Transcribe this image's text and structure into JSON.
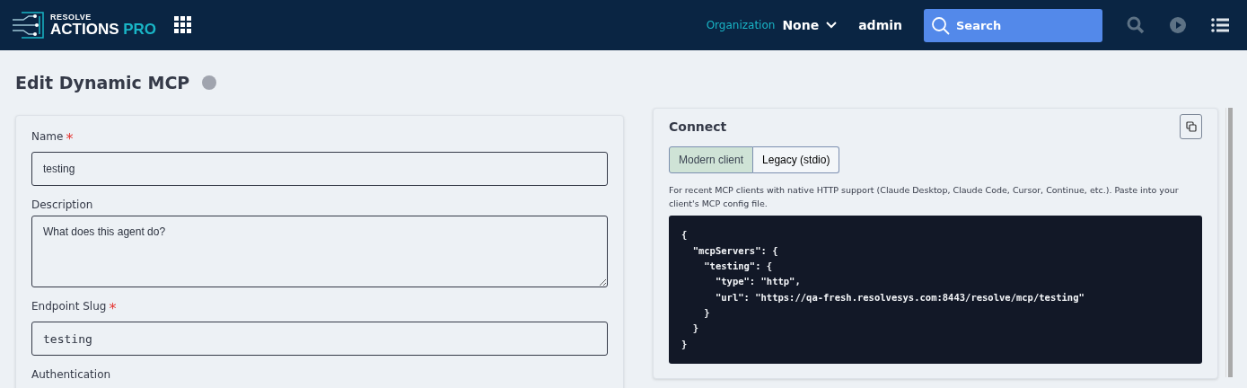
{
  "header": {
    "logo_top": "RESOLVE",
    "logo_main": "ACTIONS",
    "logo_accent": "PRO",
    "org_label": "Organization",
    "org_value": "None",
    "user": "admin",
    "search": {
      "placeholder": "Search"
    }
  },
  "page": {
    "title": "Edit Dynamic MCP"
  },
  "form": {
    "fields": [
      {
        "kind": "input",
        "label": "Name",
        "required_mark": "*",
        "value": "testing",
        "mono": false
      },
      {
        "kind": "textarea",
        "label": "Description",
        "value": "What does this agent do?",
        "mono": false
      },
      {
        "kind": "input",
        "label": "Endpoint Slug",
        "required_mark": "*",
        "value": "testing",
        "mono": true
      },
      {
        "kind": "label",
        "label": "Authentication"
      }
    ]
  },
  "connect": {
    "title": "Connect",
    "tabs": [
      {
        "label": "Modern client",
        "selected": true
      },
      {
        "label": "Legacy (stdio)",
        "selected": false
      }
    ],
    "description": "For recent MCP clients with native HTTP support (Claude Desktop, Claude Code, Cursor, Continue, etc.). Paste into your client's MCP config file.",
    "code_lines": [
      "{",
      "  \"mcpServers\": {",
      "    \"testing\": {",
      "      \"type\": \"http\",",
      "      \"url\": \"https://qa-fresh.resolvesys.com:8443/resolve/mcp/testing\"",
      "    }",
      "  }",
      "}"
    ]
  }
}
